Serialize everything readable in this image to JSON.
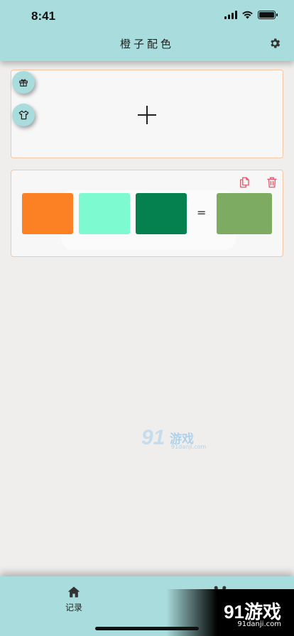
{
  "status_bar": {
    "time": "8:41"
  },
  "header": {
    "title": "橙子配色"
  },
  "icons": {
    "settings": "gear-icon",
    "gift": "gift-icon",
    "shirt": "shirt-icon",
    "add": "plus-icon",
    "copy": "copy-icon",
    "delete": "trash-icon",
    "home": "home-icon",
    "tools": "tools-icon"
  },
  "palette_card": {
    "swatches": [
      {
        "name": "color-1",
        "color": "#fc8124"
      },
      {
        "name": "color-2",
        "color": "#7efad1"
      },
      {
        "name": "color-3",
        "color": "#05804f"
      }
    ],
    "operator": "=",
    "result": {
      "name": "result-color",
      "color": "#7dab62"
    }
  },
  "colors": {
    "header_bg": "#a9dcdc",
    "page_bg": "#efeeec",
    "card_border": "#f6c7a4",
    "tool_icon": "#e8546b"
  },
  "watermark": {
    "number": "91",
    "text": "游戏",
    "url": "91danji.com"
  },
  "tabbar": {
    "tabs": [
      {
        "label": "记录"
      },
      {
        "label": ""
      }
    ]
  }
}
